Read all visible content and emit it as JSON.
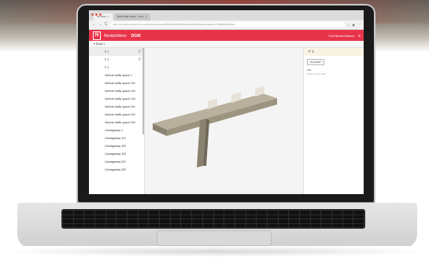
{
  "browser": {
    "tabs": [
      {
        "label": "Air Client"
      },
      {
        "label": "DGW Web Viewer - List o"
      }
    ],
    "url": "qtst.nyst.xaleb.development.novitapp/workspace/9f3fe59b6a0f428b0bbea000f1ce8e8a6e2eaa1bc17f8a9f08e3b9e3e",
    "nav_back": "←",
    "nav_forward": "→",
    "nav_reload": "C"
  },
  "app": {
    "logo_glyph": "N",
    "brand": "NovitaVidere",
    "app_name": "DGW",
    "user": "Fred Nexxed Maxers",
    "menu_icon": "≡",
    "accent": "#e8344a"
  },
  "subbar": {
    "label": "▾ Road 1"
  },
  "tree": {
    "items": [
      {
        "label": "F 1",
        "selected": true,
        "link": true
      },
      {
        "label": "F 2",
        "selected": false,
        "link": true
      },
      {
        "label": "F 3",
        "selected": false,
        "link": false
      },
      {
        "label": "Vehicle traffic space 1",
        "selected": false,
        "link": false
      },
      {
        "label": "Vehicle traffic space 101",
        "selected": false,
        "link": false
      },
      {
        "label": "Vehicle traffic space 102",
        "selected": false,
        "link": false
      },
      {
        "label": "Vehicle traffic space 103",
        "selected": false,
        "link": false
      },
      {
        "label": "Vehicle traffic space 201",
        "selected": false,
        "link": false
      },
      {
        "label": "Vehicle traffic space 202",
        "selected": false,
        "link": false
      },
      {
        "label": "Vehicle traffic space 203",
        "selected": false,
        "link": false
      },
      {
        "label": "Carriageway 1",
        "selected": false,
        "link": false
      },
      {
        "label": "Carriageway 101",
        "selected": false,
        "link": false
      },
      {
        "label": "Carriageway 102",
        "selected": false,
        "link": false
      },
      {
        "label": "Carriageway 103",
        "selected": false,
        "link": false
      },
      {
        "label": "Carriageway 201",
        "selected": false,
        "link": false
      },
      {
        "label": "Carriageway 202",
        "selected": false,
        "link": false
      }
    ]
  },
  "props": {
    "title": "F 1",
    "button": "IFC EXPT",
    "label": "URL",
    "value": "(click-to-copy link)"
  }
}
